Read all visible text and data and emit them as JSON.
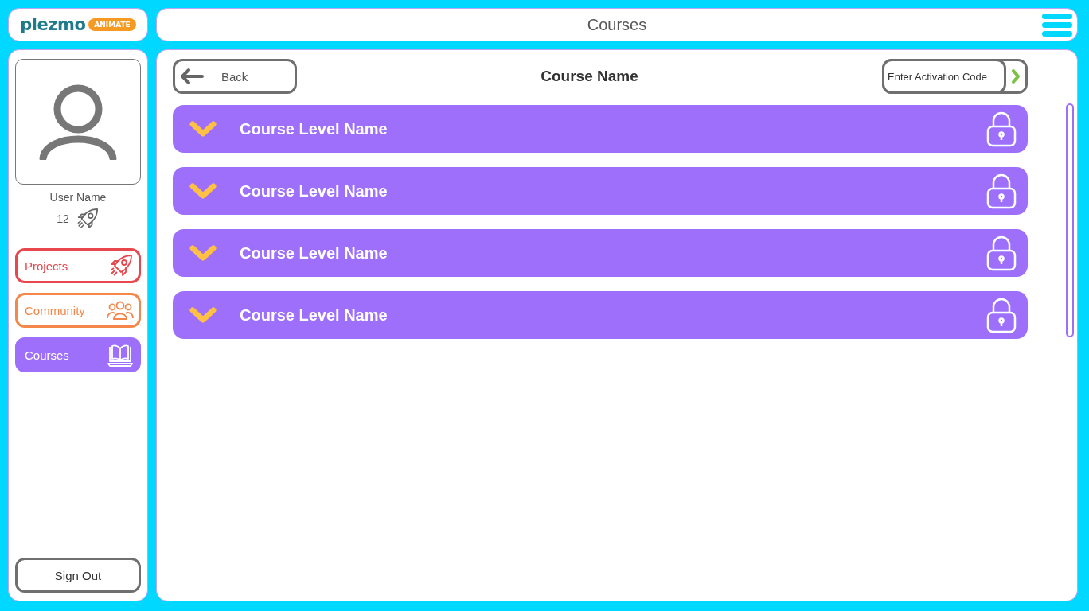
{
  "logo": {
    "name": "plezmo",
    "badge": "ANIMATE"
  },
  "header": {
    "title": "Courses"
  },
  "profile": {
    "user_name": "User Name",
    "points": "12"
  },
  "nav": [
    {
      "label": "Projects",
      "kind": "rocket",
      "color": "#e8474e",
      "selected": false
    },
    {
      "label": "Community",
      "kind": "people",
      "color": "#f5874a",
      "selected": false
    },
    {
      "label": "Courses",
      "kind": "book",
      "color": "#9d6ffb",
      "selected": true
    }
  ],
  "sign_out": "Sign Out",
  "toolbar": {
    "back": "Back",
    "title": "Course Name",
    "activation": {
      "placeholder": "Enter Activation Code"
    }
  },
  "levels": [
    {
      "name": "Course Level Name",
      "locked": true
    },
    {
      "name": "Course Level Name",
      "locked": true
    },
    {
      "name": "Course Level Name",
      "locked": true
    },
    {
      "name": "Course Level Name",
      "locked": true
    }
  ]
}
